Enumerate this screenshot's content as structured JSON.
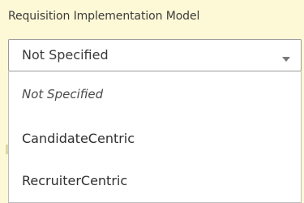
{
  "field": {
    "label": "Requisition Implementation Model",
    "selected_value": "Not Specified"
  },
  "dropdown": {
    "options": [
      {
        "label": "Not Specified"
      },
      {
        "label": "CandidateCentric"
      },
      {
        "label": "RecruiterCentric"
      }
    ]
  },
  "icons": {
    "chevron": "chevron-down-icon"
  },
  "colors": {
    "background": "#fdf8d6",
    "border": "#9a9a9a",
    "chevron": "#7a7a7a"
  }
}
